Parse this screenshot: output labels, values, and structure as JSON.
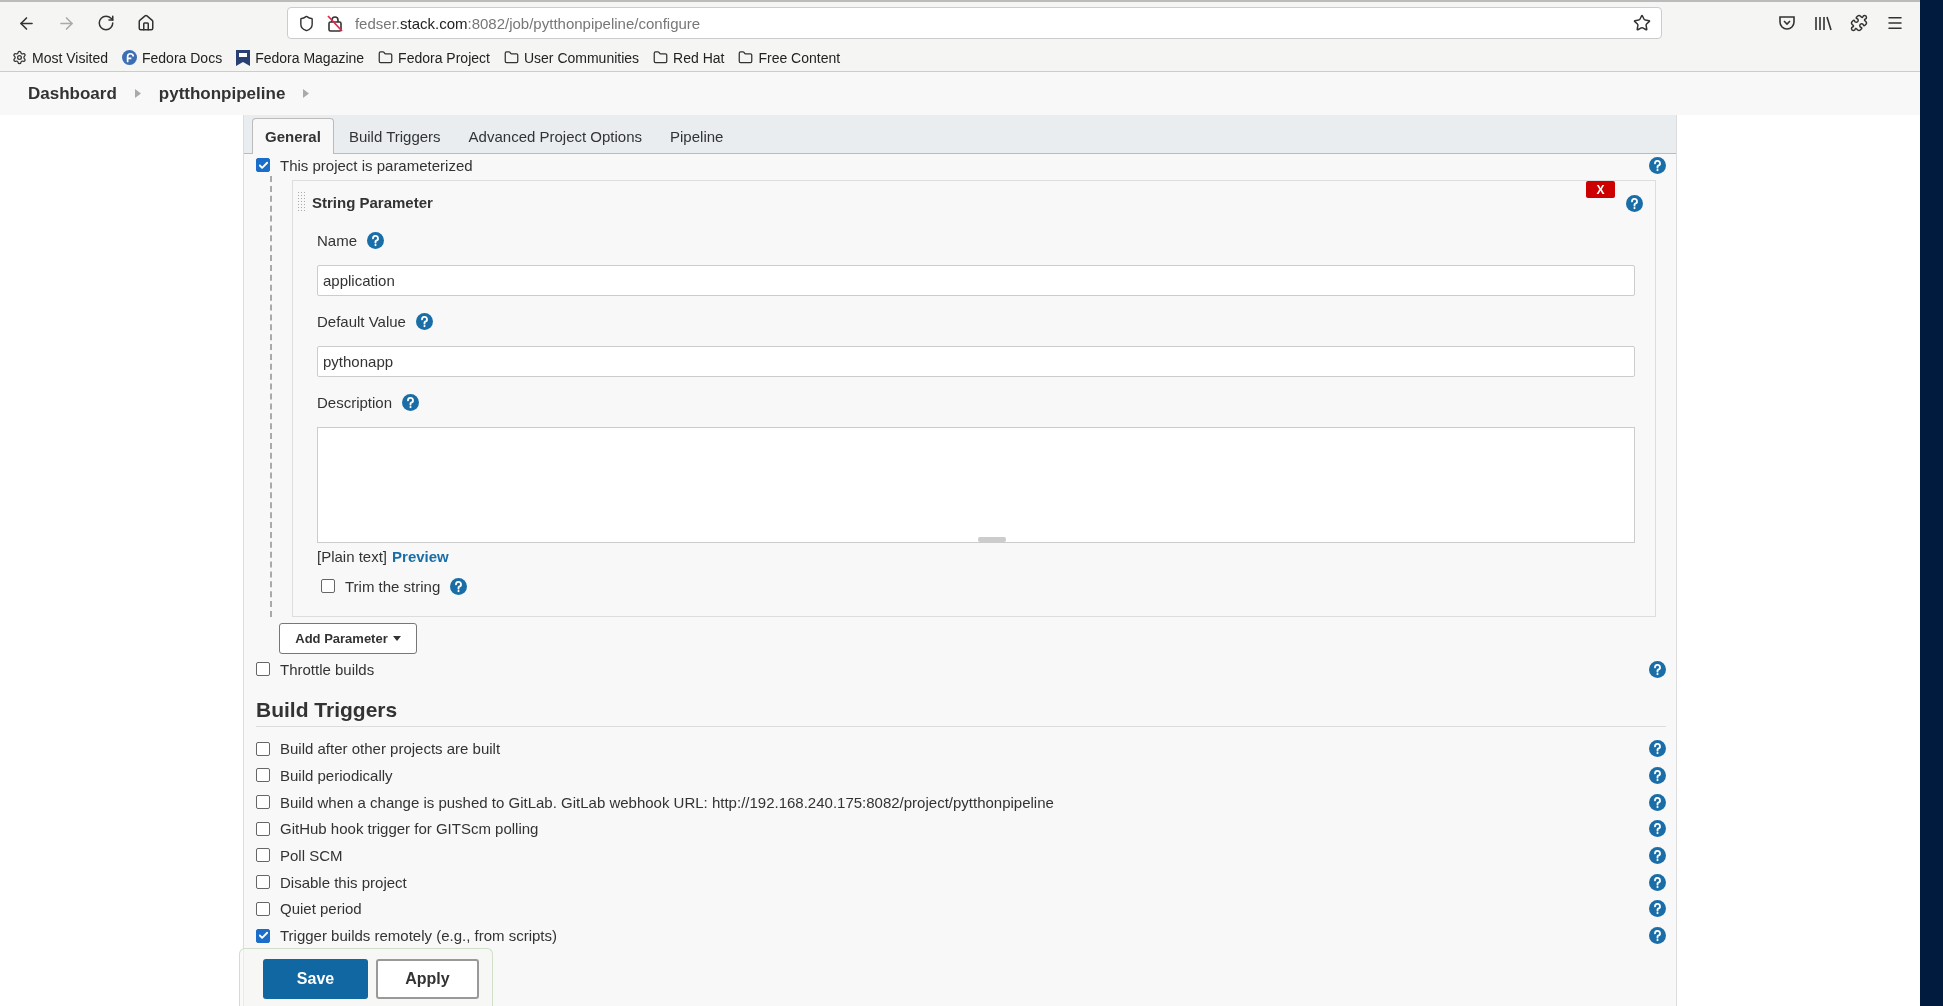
{
  "browser": {
    "url": {
      "subdomain": "fedser.",
      "domain": "stack.com",
      "path": ":8082/job/pytthonpipeline/configure"
    },
    "bookmarks": [
      {
        "kind": "gear",
        "label": "Most Visited"
      },
      {
        "kind": "fedora",
        "label": "Fedora Docs"
      },
      {
        "kind": "magazine",
        "label": "Fedora Magazine"
      },
      {
        "kind": "folder",
        "label": "Fedora Project"
      },
      {
        "kind": "folder",
        "label": "User Communities"
      },
      {
        "kind": "folder",
        "label": "Red Hat"
      },
      {
        "kind": "folder",
        "label": "Free Content"
      }
    ]
  },
  "breadcrumbs": [
    "Dashboard",
    "pytthonpipeline"
  ],
  "tabs": [
    {
      "label": "General",
      "selected": true
    },
    {
      "label": "Build Triggers",
      "selected": false
    },
    {
      "label": "Advanced Project Options",
      "selected": false
    },
    {
      "label": "Pipeline",
      "selected": false
    }
  ],
  "general": {
    "parameterized": {
      "label": "This project is parameterized",
      "checked": true
    },
    "parameter": {
      "title": "String Parameter",
      "delete": "X",
      "fields": [
        {
          "label": "Name",
          "value": "application"
        },
        {
          "label": "Default Value",
          "value": "pythonapp"
        }
      ],
      "description": {
        "label": "Description"
      },
      "format": "[Plain text]",
      "preview": "Preview",
      "trim": {
        "label": "Trim the string",
        "checked": false
      }
    },
    "add_parameter": "Add Parameter",
    "throttle": {
      "label": "Throttle builds",
      "checked": false
    }
  },
  "build_triggers": {
    "heading": "Build Triggers",
    "options": [
      {
        "label": "Build after other projects are built",
        "checked": false
      },
      {
        "label": "Build periodically",
        "checked": false
      },
      {
        "label": "Build when a change is pushed to GitLab. GitLab webhook URL: http://192.168.240.175:8082/project/pytthonpipeline",
        "checked": false
      },
      {
        "label": "GitHub hook trigger for GITScm polling",
        "checked": false
      },
      {
        "label": "Poll SCM",
        "checked": false
      },
      {
        "label": "Disable this project",
        "checked": false
      },
      {
        "label": "Quiet period",
        "checked": false
      },
      {
        "label": "Trigger builds remotely (e.g., from scripts)",
        "checked": true
      }
    ]
  },
  "actions": {
    "save": "Save",
    "apply": "Apply"
  }
}
